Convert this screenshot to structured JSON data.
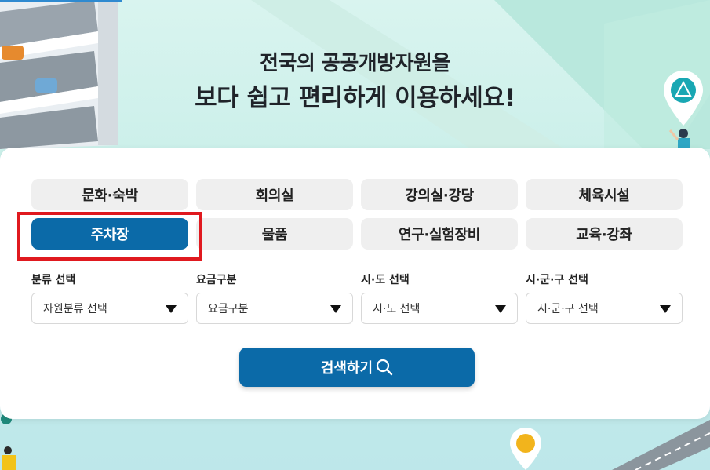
{
  "hero": {
    "headline_line1": "전국의 공공개방자원을",
    "headline_line2": "보다 쉽고 편리하게 이용하세요!"
  },
  "categories": [
    {
      "label": "문화·숙박",
      "active": false
    },
    {
      "label": "회의실",
      "active": false
    },
    {
      "label": "강의실·강당",
      "active": false
    },
    {
      "label": "체육시설",
      "active": false
    },
    {
      "label": "주차장",
      "active": true
    },
    {
      "label": "물품",
      "active": false
    },
    {
      "label": "연구·실험장비",
      "active": false
    },
    {
      "label": "교육·강좌",
      "active": false
    }
  ],
  "filters": [
    {
      "label": "분류 선택",
      "value": "자원분류 선택"
    },
    {
      "label": "요금구분",
      "value": "요금구분"
    },
    {
      "label": "시·도 선택",
      "value": "시·도 선택"
    },
    {
      "label": "시·군·구 선택",
      "value": "시·군·구 선택"
    }
  ],
  "search": {
    "label": "검색하기"
  },
  "colors": {
    "primary": "#0b6aa8",
    "highlight_border": "#e0191f",
    "tab_bg": "#efefef",
    "hero_bg": "#c9efe9"
  }
}
